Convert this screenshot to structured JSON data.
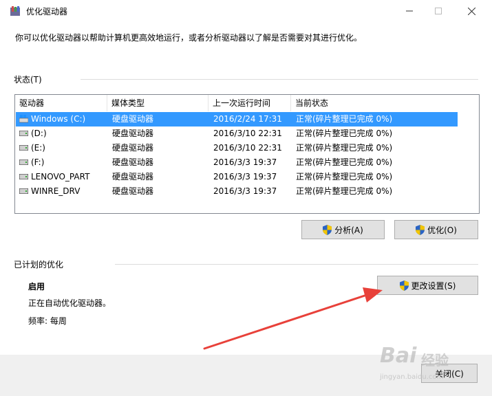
{
  "window": {
    "title": "优化驱动器",
    "minimize_icon": "minimize-icon",
    "maximize_icon": "maximize-icon",
    "close_icon": "close-icon"
  },
  "description": "你可以优化驱动器以帮助计算机更高效地运行，或者分析驱动器以了解是否需要对其进行优化。",
  "status": {
    "label": "状态(T)",
    "columns": [
      "驱动器",
      "媒体类型",
      "上一次运行时间",
      "当前状态"
    ],
    "rows": [
      {
        "drive": "Windows (C:)",
        "media": "硬盘驱动器",
        "last_run": "2016/2/24 17:31",
        "state": "正常(碎片整理已完成 0%)",
        "selected": true
      },
      {
        "drive": "(D:)",
        "media": "硬盘驱动器",
        "last_run": "2016/3/10 22:31",
        "state": "正常(碎片整理已完成 0%)"
      },
      {
        "drive": "(E:)",
        "media": "硬盘驱动器",
        "last_run": "2016/3/10 22:31",
        "state": "正常(碎片整理已完成 0%)"
      },
      {
        "drive": "(F:)",
        "media": "硬盘驱动器",
        "last_run": "2016/3/3 19:37",
        "state": "正常(碎片整理已完成 0%)"
      },
      {
        "drive": "LENOVO_PART",
        "media": "硬盘驱动器",
        "last_run": "2016/3/3 19:37",
        "state": "正常(碎片整理已完成 0%)"
      },
      {
        "drive": "WINRE_DRV",
        "media": "硬盘驱动器",
        "last_run": "2016/3/3 19:37",
        "state": "正常(碎片整理已完成 0%)"
      }
    ],
    "analyze_label": "分析(A)",
    "optimize_label": "优化(O)"
  },
  "scheduled": {
    "label": "已计划的优化",
    "state": "启用",
    "detail": "正在自动优化驱动器。",
    "frequency": "频率: 每周",
    "change_settings_label": "更改设置(S)"
  },
  "footer": {
    "close_label": "关闭(C)",
    "watermark_main": "Bai",
    "watermark_sub": "jingyan.baidu.com",
    "watermark_cn": "经验"
  },
  "colors": {
    "selection": "#3399ff",
    "arrow": "#e8413a"
  }
}
